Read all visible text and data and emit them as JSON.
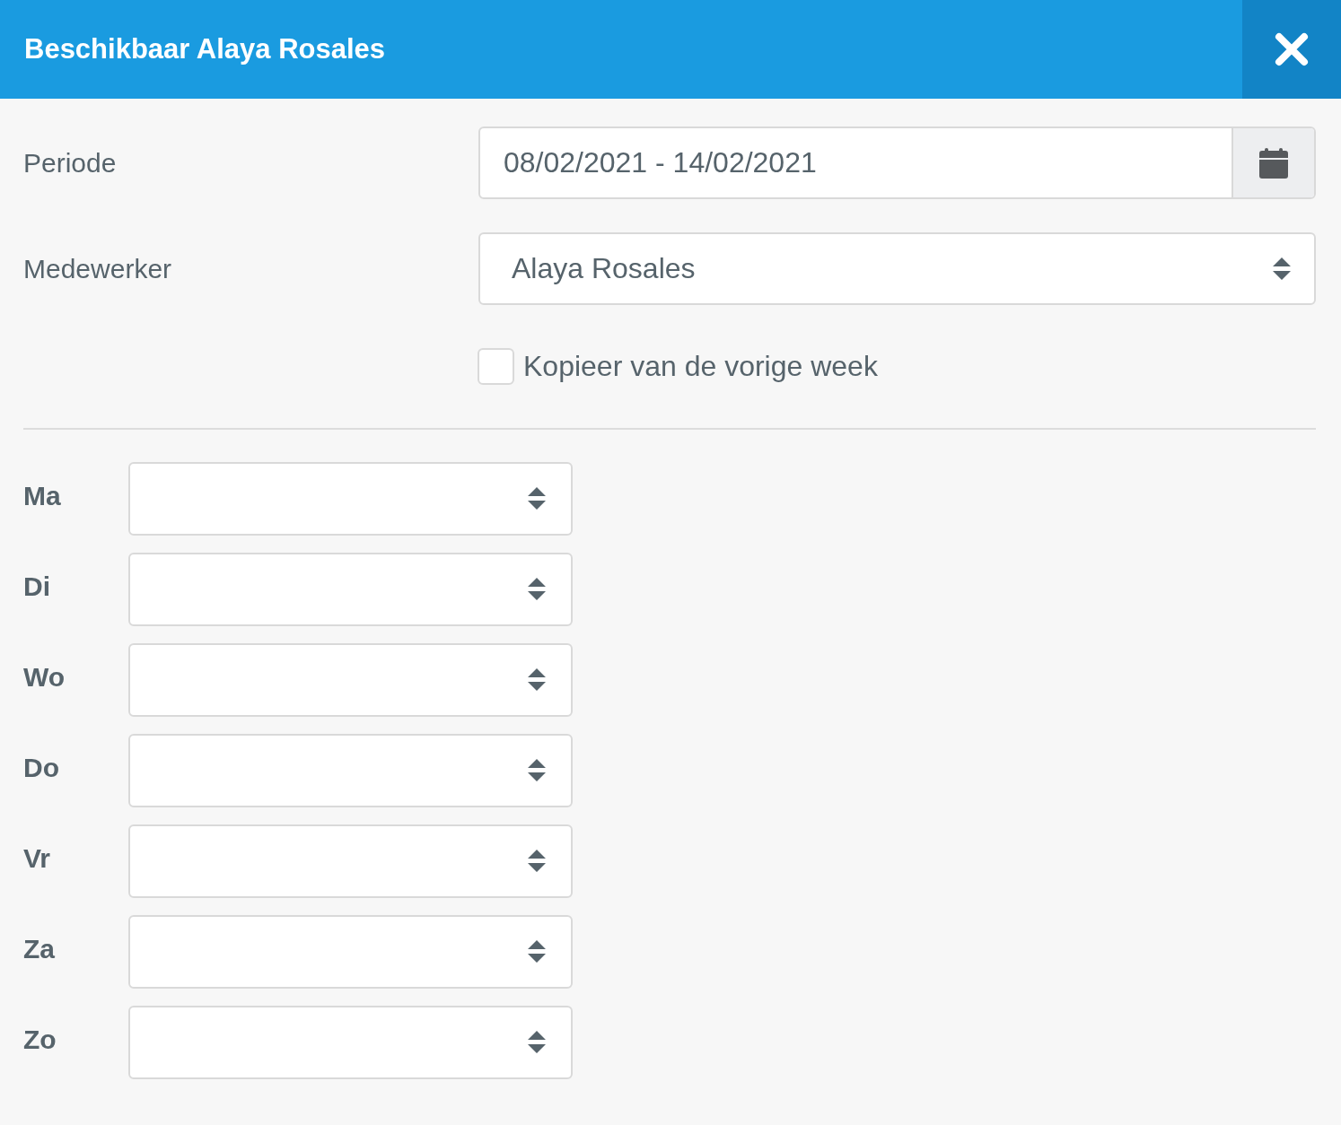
{
  "dialog": {
    "title": "Beschikbaar Alaya Rosales"
  },
  "period": {
    "label": "Periode",
    "value": "08/02/2021 - 14/02/2021"
  },
  "employee": {
    "label": "Medewerker",
    "value": "Alaya Rosales"
  },
  "copy_previous_week": {
    "label": "Kopieer van de vorige week",
    "checked": false
  },
  "days": [
    {
      "label": "Ma"
    },
    {
      "label": "Di"
    },
    {
      "label": "Wo"
    },
    {
      "label": "Do"
    },
    {
      "label": "Vr"
    },
    {
      "label": "Za"
    },
    {
      "label": "Zo"
    }
  ]
}
